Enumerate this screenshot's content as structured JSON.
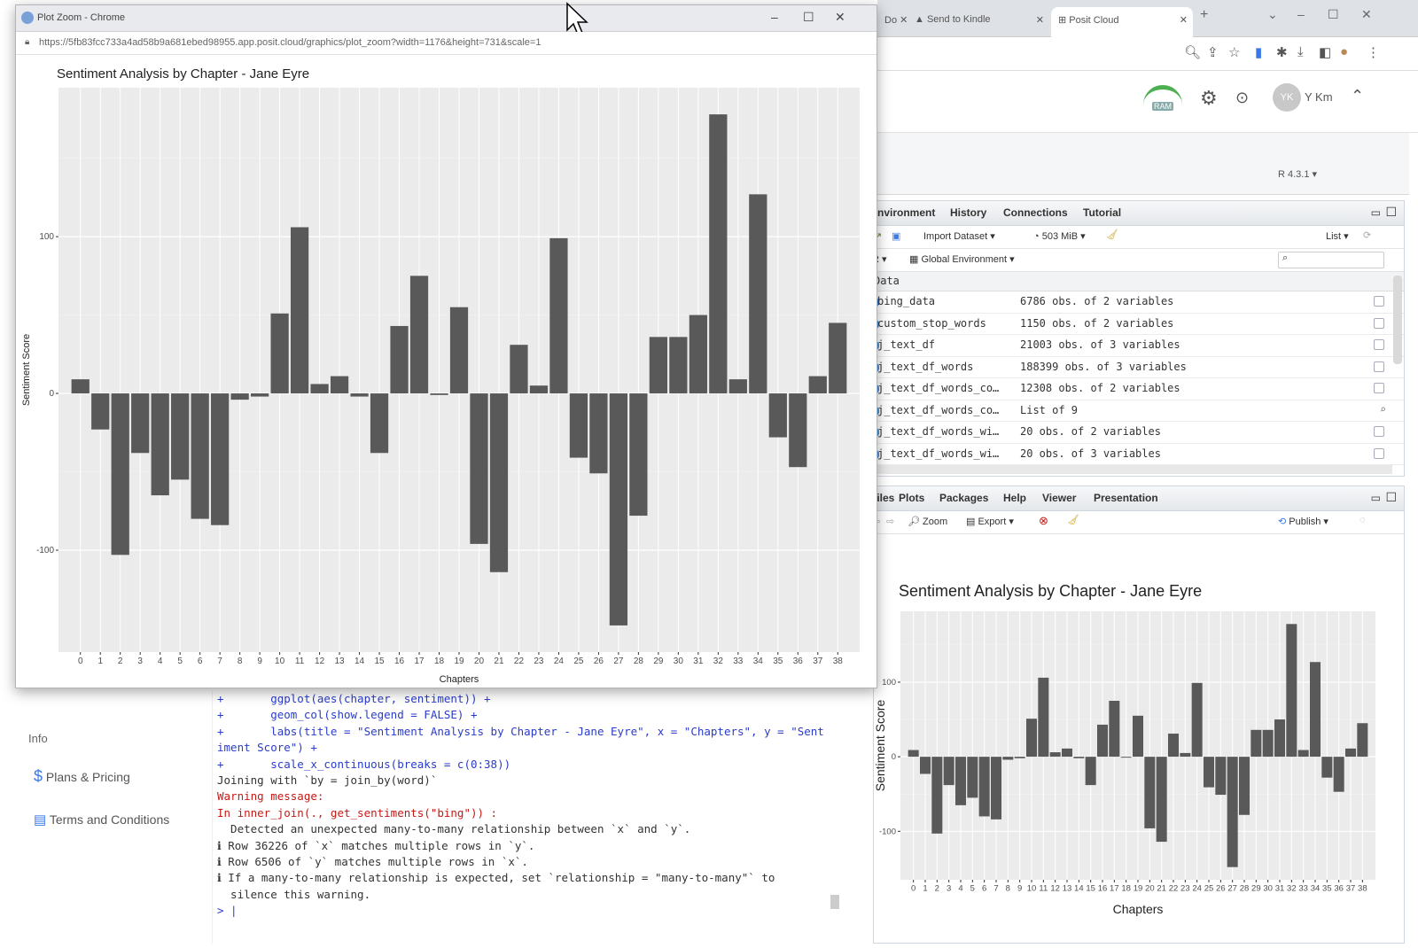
{
  "popup": {
    "title": "Plot Zoom - Chrome",
    "url": "https://5fb83fcc733a4ad58b9a681ebed98955.app.posit.cloud/graphics/plot_zoom?width=1176&height=731&scale=1",
    "controls": {
      "minimize": "–",
      "maximize": "☐",
      "close": "✕"
    }
  },
  "browser": {
    "tabs": [
      {
        "label": "Do"
      },
      {
        "label": "Send to Kindle"
      },
      {
        "label": "Posit Cloud"
      }
    ],
    "new_tab": "+",
    "window_controls": {
      "minimize": "–",
      "maximize": "☐",
      "close": "✕"
    }
  },
  "rstudio": {
    "user": {
      "initials": "YK",
      "name": "Y Km"
    },
    "r_version": "R 4.3.1 ▾",
    "ram_label": "RAM"
  },
  "env_pane": {
    "tabs": [
      "Environment",
      "History",
      "Connections",
      "Tutorial"
    ],
    "toolbar": {
      "import": "Import Dataset ▾",
      "memory": "503 MiB ▾",
      "list": "List ▾",
      "r_select": "R ▾",
      "global_env": "Global Environment ▾"
    },
    "section": "Data",
    "rows": [
      {
        "name": "bing_data",
        "value": "6786 obs. of 2 variables"
      },
      {
        "name": "custom_stop_words",
        "value": "1150 obs. of 2 variables"
      },
      {
        "name": "j_text_df",
        "value": "21003 obs. of 3 variables"
      },
      {
        "name": "j_text_df_words",
        "value": "188399 obs. of 3 variables"
      },
      {
        "name": "j_text_df_words_co…",
        "value": "12308 obs. of 2 variables"
      },
      {
        "name": "j_text_df_words_co…",
        "value": "List of  9"
      },
      {
        "name": "j_text_df_words_wi…",
        "value": "20 obs. of 2 variables"
      },
      {
        "name": "j_text_df_words_wi…",
        "value": "20 obs. of 3 variables"
      }
    ]
  },
  "plots_pane": {
    "tabs": [
      "Files",
      "Plots",
      "Packages",
      "Help",
      "Viewer",
      "Presentation"
    ],
    "toolbar": {
      "zoom": "Zoom",
      "export": "Export ▾",
      "publish": "Publish ▾"
    }
  },
  "sidebar": {
    "section": "Info",
    "items": [
      {
        "label": "Plans & Pricing"
      },
      {
        "label": "Terms and Conditions"
      }
    ]
  },
  "console": {
    "lines": [
      {
        "text": "+       ggplot(aes(chapter, sentiment)) +",
        "style": "blue"
      },
      {
        "text": "+       geom_col(show.legend = FALSE) +",
        "style": "blue"
      },
      {
        "text": "+       labs(title = \"Sentiment Analysis by Chapter - Jane Eyre\", x = \"Chapters\", y = \"Sent",
        "style": "blue"
      },
      {
        "text": "iment Score\") +",
        "style": "blue"
      },
      {
        "text": "+       scale_x_continuous(breaks = c(0:38))",
        "style": "blue"
      },
      {
        "text": "Joining with `by = join_by(word)`",
        "style": "plain"
      },
      {
        "text": "Warning message:",
        "style": "red"
      },
      {
        "text": "In inner_join(., get_sentiments(\"bing\")) :",
        "style": "red"
      },
      {
        "text": "  Detected an unexpected many-to-many relationship between `x` and `y`.",
        "style": "plain"
      },
      {
        "text": "ℹ Row 36226 of `x` matches multiple rows in `y`.",
        "style": "plain"
      },
      {
        "text": "ℹ Row 6506 of `y` matches multiple rows in `x`.",
        "style": "plain"
      },
      {
        "text": "ℹ If a many-to-many relationship is expected, set `relationship = \"many-to-many\"` to",
        "style": "plain"
      },
      {
        "text": "  silence this warning.",
        "style": "plain"
      },
      {
        "text": "> |",
        "style": "blue"
      }
    ]
  },
  "chart_data": [
    {
      "type": "bar",
      "title": "Sentiment Analysis by Chapter - Jane Eyre",
      "xlabel": "Chapters",
      "ylabel": "Sentiment Score",
      "x": [
        0,
        1,
        2,
        3,
        4,
        5,
        6,
        7,
        8,
        9,
        10,
        11,
        12,
        13,
        14,
        15,
        16,
        17,
        18,
        19,
        20,
        21,
        22,
        23,
        24,
        25,
        26,
        27,
        28,
        29,
        30,
        31,
        32,
        33,
        34,
        35,
        36,
        37,
        38
      ],
      "values": [
        9,
        -23,
        -103,
        -38,
        -65,
        -55,
        -80,
        -84,
        -4,
        -2,
        51,
        106,
        6,
        11,
        -2,
        -38,
        43,
        75,
        -1,
        55,
        -96,
        -114,
        31,
        5,
        99,
        -41,
        -51,
        -148,
        -78,
        36,
        36,
        50,
        178,
        9,
        127,
        -28,
        -47,
        11,
        45
      ],
      "yticks": [
        -100,
        0,
        100
      ],
      "ylim": [
        -165,
        195
      ],
      "grid": true
    },
    {
      "type": "bar",
      "title": "Sentiment Analysis by Chapter - Jane Eyre",
      "xlabel": "Chapters",
      "ylabel": "Sentiment Score",
      "x": [
        0,
        1,
        2,
        3,
        4,
        5,
        6,
        7,
        8,
        9,
        10,
        11,
        12,
        13,
        14,
        15,
        16,
        17,
        18,
        19,
        20,
        21,
        22,
        23,
        24,
        25,
        26,
        27,
        28,
        29,
        30,
        31,
        32,
        33,
        34,
        35,
        36,
        37,
        38
      ],
      "values": [
        9,
        -23,
        -103,
        -38,
        -65,
        -55,
        -80,
        -84,
        -4,
        -2,
        51,
        106,
        6,
        11,
        -2,
        -38,
        43,
        75,
        -1,
        55,
        -96,
        -114,
        31,
        5,
        99,
        -41,
        -51,
        -148,
        -78,
        36,
        36,
        50,
        178,
        9,
        127,
        -28,
        -47,
        11,
        45
      ],
      "yticks": [
        -100,
        0,
        100
      ],
      "ylim": [
        -165,
        195
      ],
      "grid": true
    }
  ]
}
